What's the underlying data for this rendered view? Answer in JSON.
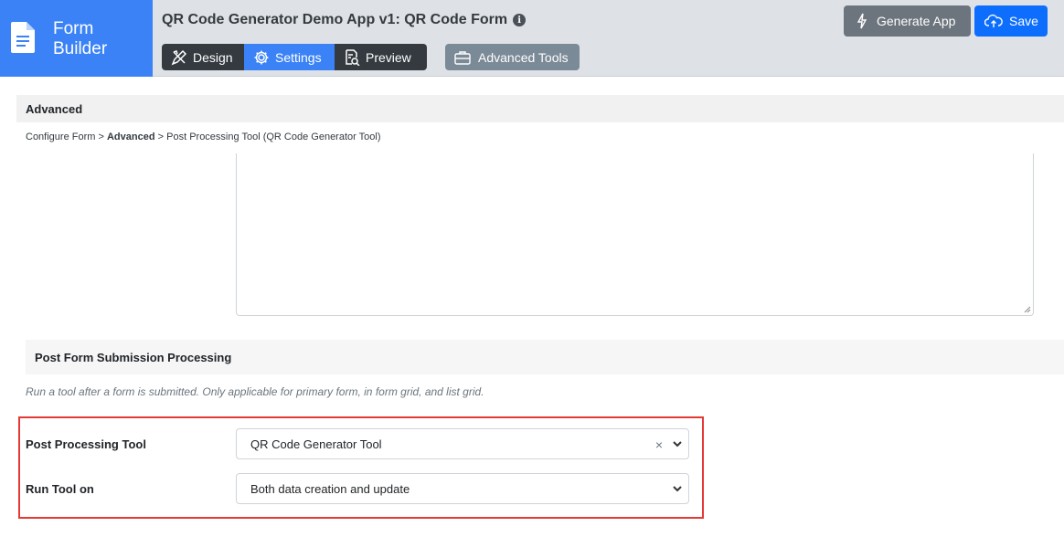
{
  "brand": {
    "line1": "Form",
    "line2": "Builder",
    "icon": "document-icon",
    "color": "#3b82f6"
  },
  "header": {
    "title": "QR Code Generator Demo App v1: QR Code Form",
    "tabs": [
      {
        "label": "Design",
        "icon": "pencil-ruler-icon"
      },
      {
        "label": "Settings",
        "icon": "gear-icon",
        "active": true
      },
      {
        "label": "Preview",
        "icon": "search-document-icon"
      }
    ],
    "advanced_tools": "Advanced Tools",
    "generate": "Generate App",
    "save": "Save"
  },
  "section": {
    "title": "Advanced"
  },
  "breadcrumb": {
    "part1": "Configure Form",
    "sep": ">",
    "part2": "Advanced",
    "part3": "Post Processing Tool (QR Code Generator Tool)"
  },
  "post_processing": {
    "title": "Post Form Submission Processing",
    "help": "Run a tool after a form is submitted. Only applicable for primary form, in form grid, and list grid.",
    "tool_label": "Post Processing Tool",
    "tool_value": "QR Code Generator Tool",
    "clear_symbol": "×",
    "run_label": "Run Tool on",
    "run_value": "Both data creation and update"
  }
}
